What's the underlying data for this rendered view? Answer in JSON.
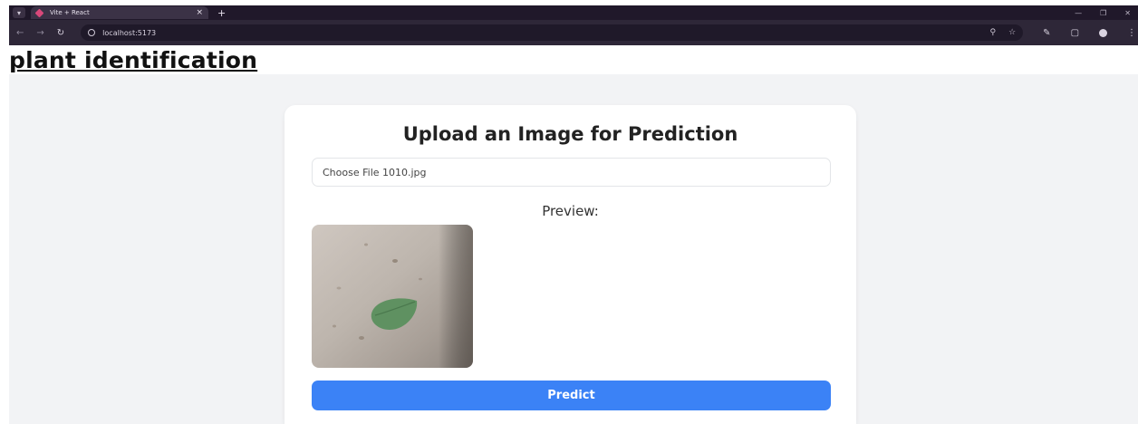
{
  "browser": {
    "tab_title": "Vite + React",
    "url": "localhost:5173"
  },
  "page": {
    "title": "plant identification"
  },
  "upload_card": {
    "heading": "Upload an Image for Prediction",
    "file_input_text": "Choose File 1010.jpg",
    "preview_label": "Preview:",
    "predict_label": "Predict"
  },
  "colors": {
    "accent": "#3b82f6",
    "page_background": "#f2f3f5",
    "browser_chrome": "#2e2738"
  },
  "icons": [
    "tab-menu-icon",
    "tab-favicon-icon",
    "close-icon",
    "new-tab-icon",
    "back-icon",
    "forward-icon",
    "reload-icon",
    "site-info-icon",
    "zoom-icon",
    "bookmark-star-icon",
    "extensions-icon",
    "sidebar-icon",
    "profile-icon",
    "menu-icon"
  ]
}
